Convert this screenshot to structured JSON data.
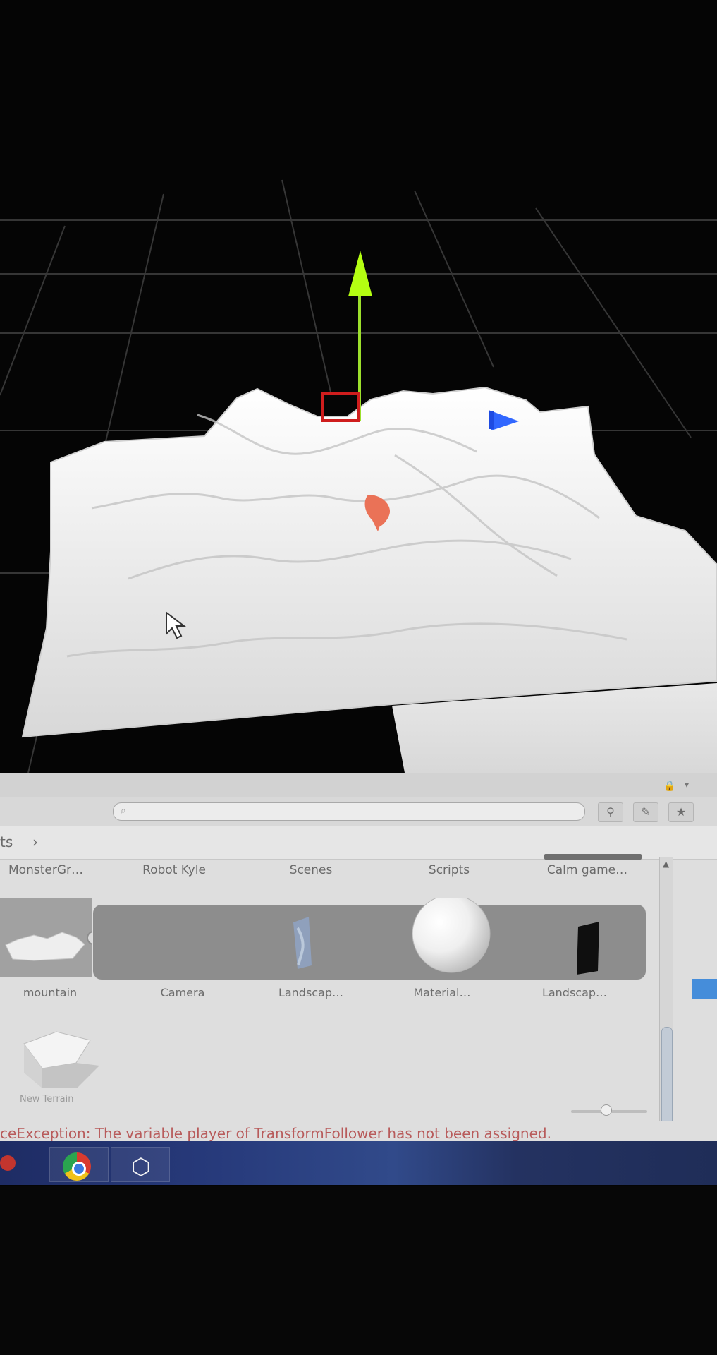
{
  "breadcrumb": {
    "current": "ts",
    "separator": "›"
  },
  "folders": [
    {
      "label": "MonsterGr…"
    },
    {
      "label": "Robot Kyle"
    },
    {
      "label": "Scenes"
    },
    {
      "label": "Scripts"
    },
    {
      "label": "Calm game…"
    }
  ],
  "assets": [
    {
      "label": "mountain"
    },
    {
      "label": "Camera"
    },
    {
      "label": "Landscap…"
    },
    {
      "label": "Material…"
    },
    {
      "label": "Landscap…"
    }
  ],
  "extra_asset": {
    "label": "New Terrain"
  },
  "console": {
    "message": "ceException: The variable player of TransformFollower has not been assigned."
  },
  "icons": {
    "search": "search-icon",
    "lock": "lock-icon",
    "menu": "menu-icon",
    "filter": "filter-icon",
    "label": "tag-icon",
    "favorite": "star-icon"
  },
  "taskbar": {
    "apps": [
      "chrome",
      "unity"
    ]
  }
}
